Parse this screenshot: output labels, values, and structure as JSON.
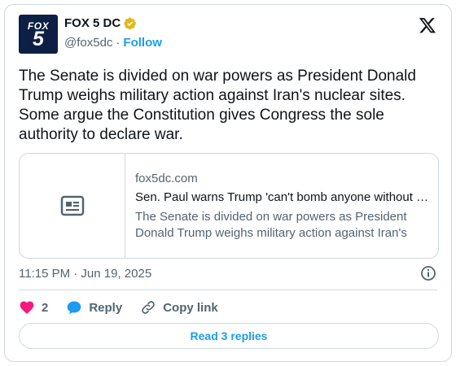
{
  "account": {
    "name": "FOX 5 DC",
    "handle": "@fox5dc",
    "separator": "·",
    "follow_label": "Follow",
    "verified": true,
    "avatar_top": "FOX",
    "avatar_bottom": "5"
  },
  "tweet": {
    "text": "The Senate is divided on war powers as President Donald Trump weighs military action against Iran's nuclear sites. Some argue the Constitution gives Congress the sole authority to declare war.",
    "timestamp": "11:15 PM · Jun 19, 2025"
  },
  "link_card": {
    "domain": "fox5dc.com",
    "title": "Sen. Paul warns Trump 'can't bomb anyone without congressional approval' amid Iran tensions",
    "description": "The Senate is divided on war powers as President Donald Trump weighs military action against Iran's nuclear sites."
  },
  "actions": {
    "like_count": "2",
    "reply_label": "Reply",
    "copy_link_label": "Copy link"
  },
  "replies_button": {
    "label": "Read 3 replies"
  },
  "colors": {
    "accent": "#1d9bf0",
    "like": "#f91880",
    "verified_gold": "#e2b719",
    "avatar_bg": "#0d1f44",
    "text_secondary": "#536471",
    "border": "#cfd9de"
  },
  "icons": [
    "verified-badge-icon",
    "x-logo-icon",
    "article-icon",
    "info-icon",
    "heart-icon",
    "reply-bubble-icon",
    "link-icon"
  ]
}
